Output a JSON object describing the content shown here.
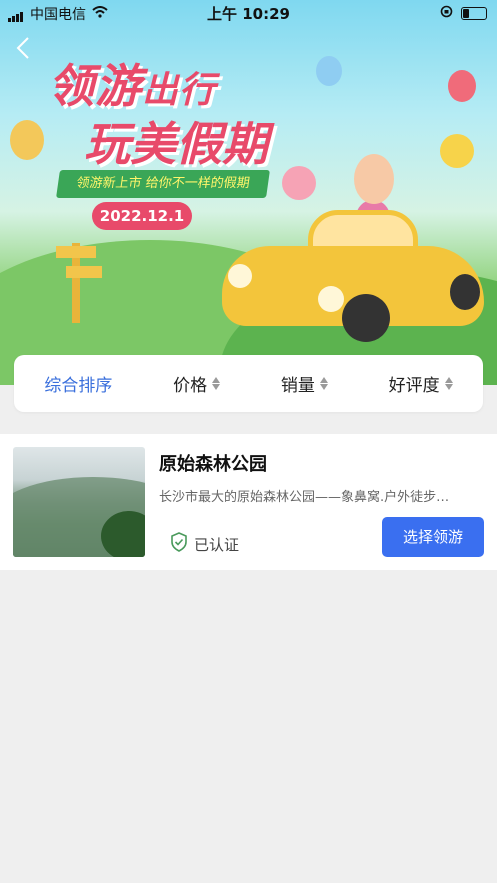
{
  "status_bar": {
    "carrier": "中国电信",
    "time": "上午 10:29"
  },
  "banner": {
    "title_line1_big": "领游",
    "title_line1_small": "出行",
    "title_line2": "玩美假期",
    "ribbon_text": "领游新上市  给你不一样的假期",
    "date": "2022.12.1"
  },
  "sort_bar": {
    "items": [
      {
        "label": "综合排序",
        "active": true
      },
      {
        "label": "价格",
        "active": false
      },
      {
        "label": "销量",
        "active": false
      },
      {
        "label": "好评度",
        "active": false
      }
    ]
  },
  "listing": {
    "title": "原始森林公园",
    "description": "长沙市最大的原始森林公园——象鼻窝.户外徒步…",
    "verified_label": "已认证",
    "select_button_label": "选择领游"
  },
  "colors": {
    "accent_blue": "#3a6ff0",
    "active_sort": "#3a6fdc",
    "banner_pink": "#e84a6a",
    "ribbon_green": "#3aa657"
  }
}
